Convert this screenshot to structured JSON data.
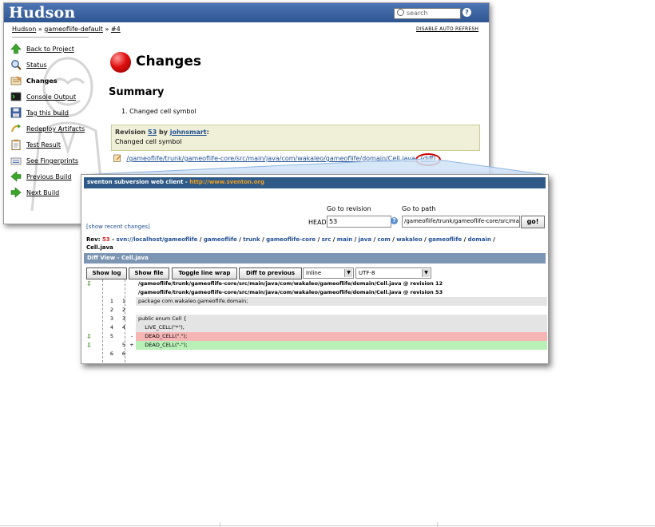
{
  "hudson": {
    "logo": "Hudson",
    "search_placeholder": "search",
    "help": "?",
    "breadcrumb": {
      "root": "Hudson",
      "sep1": "»",
      "project": "gameoflife-default",
      "sep2": "»",
      "build": "#4"
    },
    "auto_refresh": "DISABLE AUTO REFRESH",
    "sidebar": [
      {
        "label": "Back to Project",
        "icon": "up-arrow-icon"
      },
      {
        "label": "Status",
        "icon": "magnifier-icon"
      },
      {
        "label": "Changes",
        "icon": "notepad-icon"
      },
      {
        "label": "Console Output",
        "icon": "terminal-icon"
      },
      {
        "label": "Tag this build",
        "icon": "save-icon"
      },
      {
        "label": "Redeploy Artifacts",
        "icon": "redeploy-icon"
      },
      {
        "label": "Test Result",
        "icon": "clipboard-icon"
      },
      {
        "label": "See Fingerprints",
        "icon": "fingerprint-icon"
      },
      {
        "label": "Previous Build",
        "icon": "left-arrow-icon"
      },
      {
        "label": "Next Build",
        "icon": "right-arrow-icon"
      }
    ],
    "page_title": "Changes",
    "summary_title": "Summary",
    "summary_item": "1.   Changed cell symbol",
    "revision": {
      "prefix": "Revision",
      "number": "53",
      "by": "by",
      "author": "johnsmart",
      "colon": ":",
      "message": "Changed cell symbol"
    },
    "changed_path": "/gameoflife/trunk/gameoflife-core/src/main/java/com/wakaleo/gameoflife/domain/Cell.java",
    "diff_link": "(diff)"
  },
  "sventon": {
    "title_prefix": "sventon subversion web client - ",
    "title_url": "http://www.sventon.org",
    "goto_revision_label": "Go to revision",
    "goto_path_label": "Go to path",
    "head_label": "HEAD",
    "revision_value": "53",
    "path_value": "/gameoflife/trunk/gameoflife-core/src/main/java/com/wakaleo/gameoflife/domain/Cell.java",
    "go_button": "go!",
    "show_recent": "[show recent changes]",
    "rev_label": "Rev:",
    "rev_number": "53",
    "crumb_dash": " - ",
    "crumbs": [
      "svn://localhost/gameoflife",
      "gameoflife",
      "trunk",
      "gameoflife-core",
      "src",
      "main",
      "java",
      "com",
      "wakaleo",
      "gameoflife",
      "domain"
    ],
    "crumb_sep": " / ",
    "crumb_file": "Cell.java",
    "diff_view_title": "Diff View - Cell.java",
    "buttons": {
      "show_log": "Show log",
      "show_file": "Show file",
      "toggle_wrap": "Toggle line wrap",
      "diff_prev": "Diff to previous"
    },
    "view_mode": "Inline",
    "encoding": "UTF-8",
    "diff_header_1": "/gameoflife/trunk/gameoflife-core/src/main/java/com/wakaleo/gameoflife/domain/Cell.java @ revision 12",
    "diff_header_2": "/gameoflife/trunk/gameoflife-core/src/main/java/com/wakaleo/gameoflife/domain/Cell.java @ revision 53",
    "diff_rows": [
      {
        "l": "1",
        "r": "1",
        "m": "",
        "code": "package com.wakaleo.gameoflife.domain;",
        "type": "ctx"
      },
      {
        "l": "2",
        "r": "2",
        "m": "",
        "code": "",
        "type": "ctx"
      },
      {
        "l": "3",
        "r": "3",
        "m": "",
        "code": "public enum Cell {",
        "type": "ctx"
      },
      {
        "l": "4",
        "r": "4",
        "m": "",
        "code": "    LIVE_CELL(\"*\"),",
        "type": "ctx"
      },
      {
        "l": "5",
        "r": "",
        "m": "-",
        "code": "    DEAD_CELL(\".\");",
        "type": "del"
      },
      {
        "l": "",
        "r": "5",
        "m": "+",
        "code": "    DEAD_CELL(\"-\");",
        "type": "add"
      },
      {
        "l": "6",
        "r": "6",
        "m": "",
        "code": "",
        "type": "ctx"
      }
    ]
  },
  "colors": {
    "hudson_header": "#2e5590",
    "sventon_bar": "#2f5a88",
    "deleted": "#f5b5b5",
    "added": "#b8f0b8",
    "link": "#214f93"
  }
}
